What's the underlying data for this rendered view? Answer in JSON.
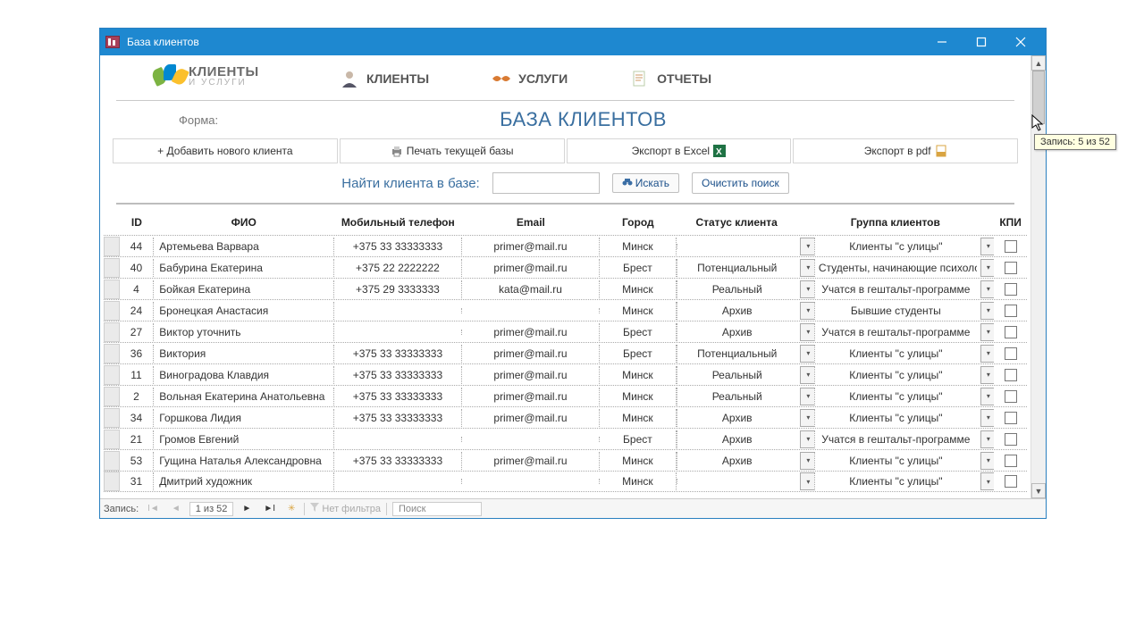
{
  "window": {
    "title": "База клиентов"
  },
  "logo": {
    "line1": "КЛИЕНТЫ",
    "line2": "И УСЛУГИ"
  },
  "nav": {
    "clients": "КЛИЕНТЫ",
    "services": "УСЛУГИ",
    "reports": "ОТЧЕТЫ"
  },
  "form_label": "Форма:",
  "page_title": "БАЗА КЛИЕНТОВ",
  "toolbar": {
    "add": "+ Добавить нового клиента",
    "print": "Печать текущей базы",
    "excel": "Экспорт в Excel",
    "pdf": "Экспорт в pdf"
  },
  "search": {
    "label": "Найти клиента в базе:",
    "value": "",
    "go": "Искать",
    "clear": "Очистить поиск"
  },
  "columns": {
    "id": "ID",
    "fio": "ФИО",
    "phone": "Мобильный телефон",
    "email": "Email",
    "city": "Город",
    "status": "Статус клиента",
    "group": "Группа клиентов",
    "kpi": "КПИ"
  },
  "rows": [
    {
      "id": "44",
      "fio": "Артемьева Варвара",
      "phone": "+375 33 33333333",
      "email": "primer@mail.ru",
      "city": "Минск",
      "status": "",
      "group": "Клиенты \"с улицы\""
    },
    {
      "id": "40",
      "fio": "Бабурина Екатерина",
      "phone": "+375 22 2222222",
      "email": "primer@mail.ru",
      "city": "Брест",
      "status": "Потенциальный",
      "group": "Студенты, начинающие психологи"
    },
    {
      "id": "4",
      "fio": "Бойкая Екатерина",
      "phone": "+375 29 3333333",
      "email": "kata@mail.ru",
      "city": "Минск",
      "status": "Реальный",
      "group": "Учатся в гештальт-программе"
    },
    {
      "id": "24",
      "fio": "Бронецкая Анастасия",
      "phone": "",
      "email": "",
      "city": "Минск",
      "status": "Архив",
      "group": "Бывшие студенты"
    },
    {
      "id": "27",
      "fio": "Виктор уточнить",
      "phone": "",
      "email": "primer@mail.ru",
      "city": "Брест",
      "status": "Архив",
      "group": "Учатся в гештальт-программе"
    },
    {
      "id": "36",
      "fio": "Виктория",
      "phone": "+375 33 33333333",
      "email": "primer@mail.ru",
      "city": "Брест",
      "status": "Потенциальный",
      "group": "Клиенты \"с улицы\""
    },
    {
      "id": "11",
      "fio": "Виноградова Клавдия",
      "phone": "+375 33 33333333",
      "email": "primer@mail.ru",
      "city": "Минск",
      "status": "Реальный",
      "group": "Клиенты \"с улицы\""
    },
    {
      "id": "2",
      "fio": "Вольная Екатерина Анатольевна",
      "phone": "+375 33 33333333",
      "email": "primer@mail.ru",
      "city": "Минск",
      "status": "Реальный",
      "group": "Клиенты \"с улицы\""
    },
    {
      "id": "34",
      "fio": "Горшкова Лидия",
      "phone": "+375 33 33333333",
      "email": "primer@mail.ru",
      "city": "Минск",
      "status": "Архив",
      "group": "Клиенты \"с улицы\""
    },
    {
      "id": "21",
      "fio": "Громов Евгений",
      "phone": "",
      "email": "",
      "city": "Брест",
      "status": "Архив",
      "group": "Учатся в гештальт-программе"
    },
    {
      "id": "53",
      "fio": "Гущина Наталья Александровна",
      "phone": "+375 33 33333333",
      "email": "primer@mail.ru",
      "city": "Минск",
      "status": "Архив",
      "group": "Клиенты \"с улицы\""
    },
    {
      "id": "31",
      "fio": "Дмитрий художник",
      "phone": "",
      "email": "",
      "city": "Минск",
      "status": "",
      "group": "Клиенты \"с улицы\""
    }
  ],
  "statusbar": {
    "record_label": "Запись:",
    "position": "1 из 52",
    "no_filter": "Нет фильтра",
    "search_placeholder": "Поиск"
  },
  "tooltip": "Запись: 5 из 52"
}
